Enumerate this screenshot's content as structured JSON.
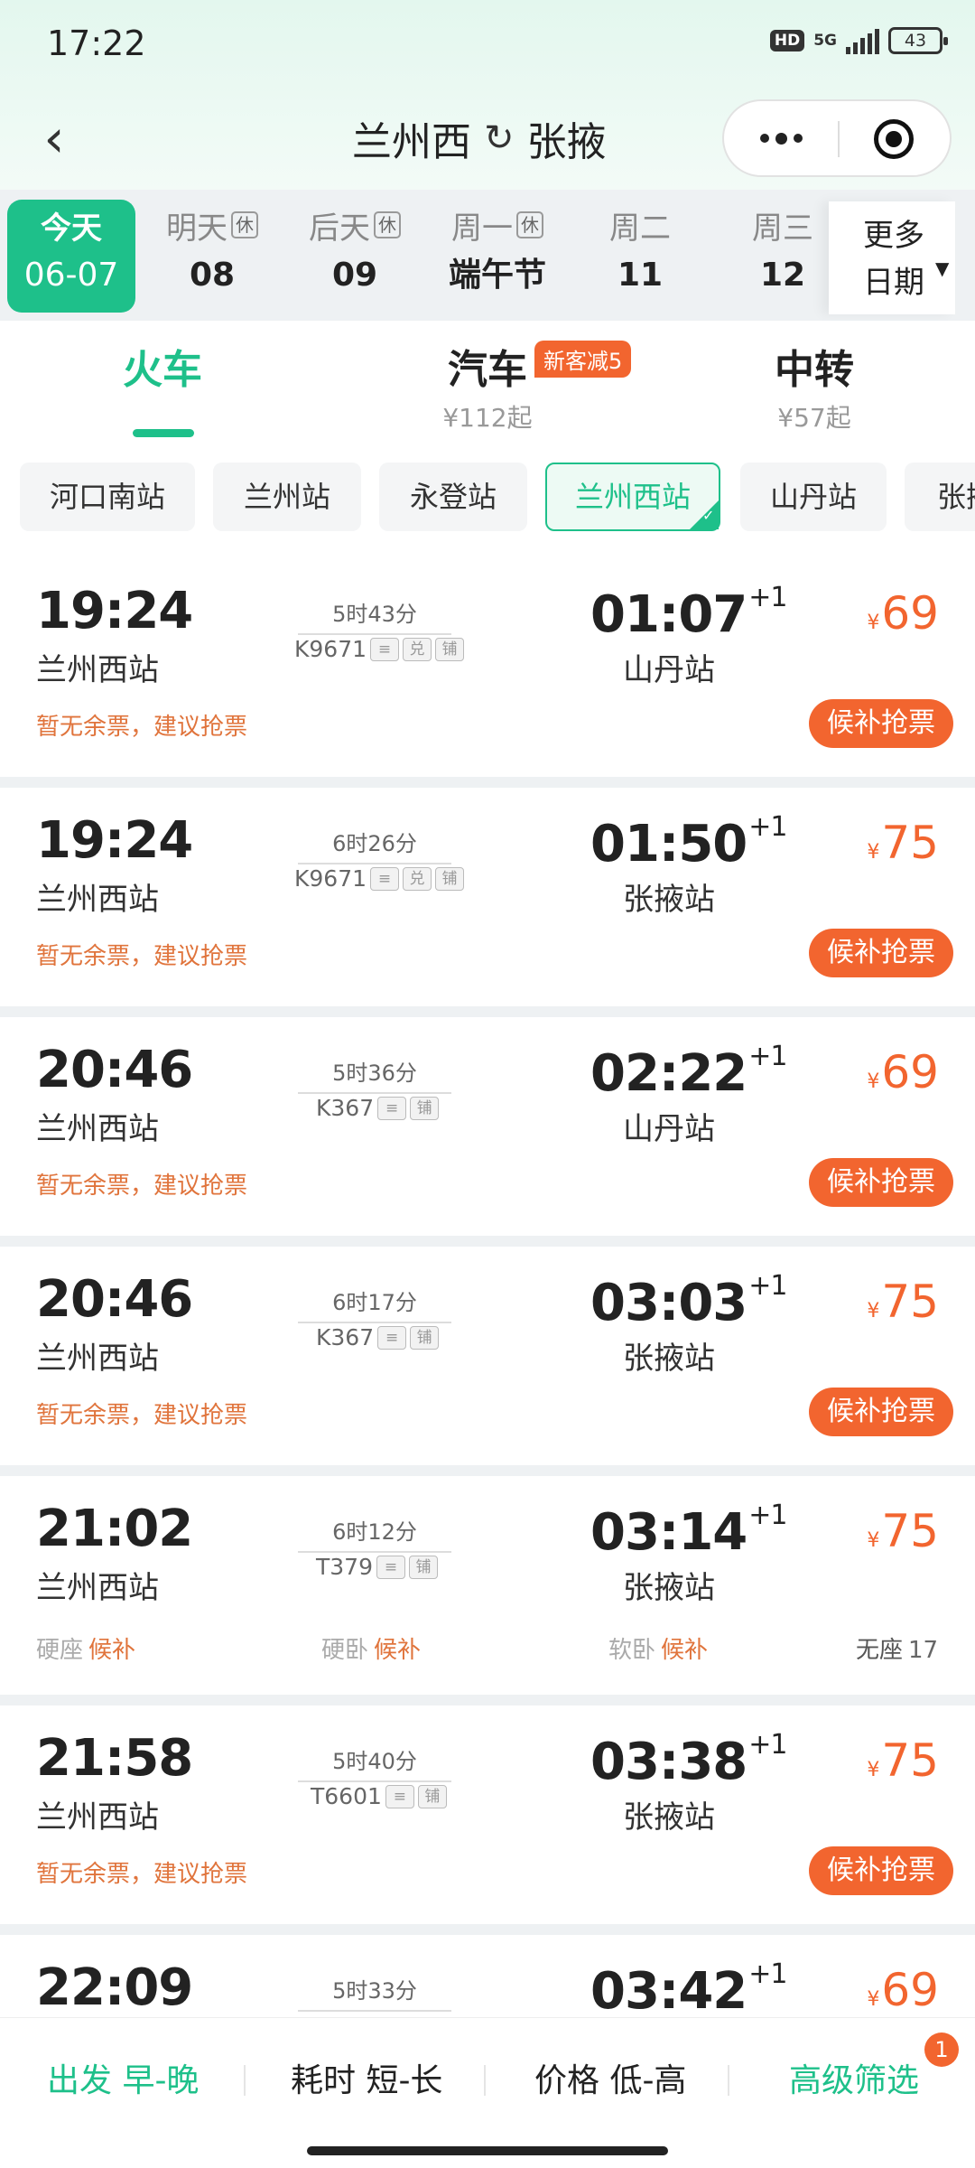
{
  "status_bar": {
    "time": "17:22",
    "hd": "HD",
    "network": "5G",
    "battery": "43"
  },
  "header": {
    "from": "兰州西",
    "to": "张掖",
    "icons": [
      "back-arrow-icon",
      "swap-icon",
      "more-dots-icon",
      "close-target-icon"
    ]
  },
  "dates": [
    {
      "week": "今天",
      "day": "06-07",
      "rest": ""
    },
    {
      "week": "明天",
      "day": "08",
      "rest": "休"
    },
    {
      "week": "后天",
      "day": "09",
      "rest": "休"
    },
    {
      "week": "周一",
      "day": "端午节",
      "rest": "休"
    },
    {
      "week": "周二",
      "day": "11",
      "rest": ""
    },
    {
      "week": "周三",
      "day": "12",
      "rest": ""
    }
  ],
  "more_dates": {
    "line1": "更多",
    "line2": "日期"
  },
  "modes": [
    {
      "name": "火车",
      "sub": ""
    },
    {
      "name": "汽车",
      "sub": "¥112起",
      "badge": "新客减5"
    },
    {
      "name": "中转",
      "sub": "¥57起"
    }
  ],
  "stations": [
    "河口南站",
    "兰州站",
    "永登站",
    "兰州西站",
    "山丹站",
    "张掖站"
  ],
  "trains": [
    {
      "dep": "19:24",
      "dep_station": "兰州西站",
      "duration": "5时43分",
      "no": "K9671",
      "tags": [
        "兑",
        "铺"
      ],
      "arr": "01:07",
      "plus": "+1",
      "arr_station": "山丹站",
      "currency": "¥",
      "price": "69",
      "status": "暂无余票，建议抢票",
      "button": "候补抢票"
    },
    {
      "dep": "19:24",
      "dep_station": "兰州西站",
      "duration": "6时26分",
      "no": "K9671",
      "tags": [
        "兑",
        "铺"
      ],
      "arr": "01:50",
      "plus": "+1",
      "arr_station": "张掖站",
      "currency": "¥",
      "price": "75",
      "status": "暂无余票，建议抢票",
      "button": "候补抢票"
    },
    {
      "dep": "20:46",
      "dep_station": "兰州西站",
      "duration": "5时36分",
      "no": "K367",
      "tags": [
        "铺"
      ],
      "arr": "02:22",
      "plus": "+1",
      "arr_station": "山丹站",
      "currency": "¥",
      "price": "69",
      "status": "暂无余票，建议抢票",
      "button": "候补抢票"
    },
    {
      "dep": "20:46",
      "dep_station": "兰州西站",
      "duration": "6时17分",
      "no": "K367",
      "tags": [
        "铺"
      ],
      "arr": "03:03",
      "plus": "+1",
      "arr_station": "张掖站",
      "currency": "¥",
      "price": "75",
      "status": "暂无余票，建议抢票",
      "button": "候补抢票"
    },
    {
      "dep": "21:02",
      "dep_station": "兰州西站",
      "duration": "6时12分",
      "no": "T379",
      "tags": [
        "铺"
      ],
      "arr": "03:14",
      "plus": "+1",
      "arr_station": "张掖站",
      "currency": "¥",
      "price": "75",
      "seats": [
        {
          "type": "硬座",
          "status": "候补"
        },
        {
          "type": "硬卧",
          "status": "候补"
        },
        {
          "type": "软卧",
          "status": "候补"
        },
        {
          "type": "无座",
          "status": "17"
        }
      ]
    },
    {
      "dep": "21:58",
      "dep_station": "兰州西站",
      "duration": "5时40分",
      "no": "T6601",
      "tags": [
        "铺"
      ],
      "arr": "03:38",
      "plus": "+1",
      "arr_station": "张掖站",
      "currency": "¥",
      "price": "75",
      "status": "暂无余票，建议抢票",
      "button": "候补抢票"
    },
    {
      "dep": "22:09",
      "dep_station": "",
      "duration": "5时33分",
      "no": "",
      "tags": [],
      "arr": "03:42",
      "plus": "+1",
      "arr_station": "",
      "currency": "¥",
      "price": "69"
    }
  ],
  "bottom_bar": {
    "items": [
      "出发 早-晚",
      "耗时 短-长",
      "价格 低-高",
      "高级筛选"
    ],
    "badge": "1"
  },
  "colors": {
    "accent_green": "#1ec08a",
    "accent_orange": "#f2652f"
  }
}
